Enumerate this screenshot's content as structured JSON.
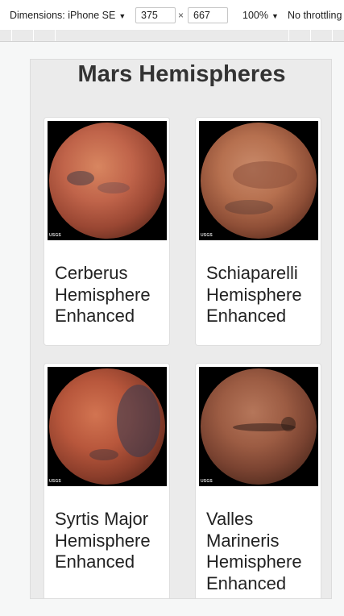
{
  "devtools": {
    "dimensions_label": "Dimensions: iPhone SE",
    "width": "375",
    "height": "667",
    "times": "×",
    "zoom": "100%",
    "throttling": "No throttling"
  },
  "page": {
    "title": "Mars Hemispheres"
  },
  "hemispheres": [
    {
      "title": "Cerberus Hemisphere Enhanced",
      "image_logo": "USGS"
    },
    {
      "title": "Schiaparelli Hemisphere Enhanced",
      "image_logo": "USGS"
    },
    {
      "title": "Syrtis Major Hemisphere Enhanced",
      "image_logo": "USGS"
    },
    {
      "title": "Valles Marineris Hemisphere Enhanced",
      "image_logo": "USGS"
    }
  ]
}
